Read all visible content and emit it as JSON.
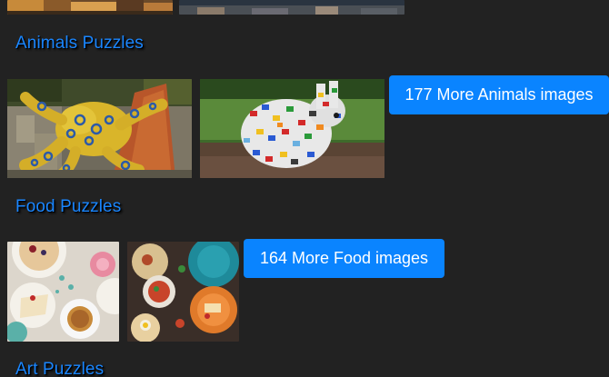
{
  "sections": [
    {
      "title": "Animals Puzzles",
      "more_label": "177 More Animals images",
      "images": [
        "lego-octopus-image",
        "lego-colorful-bunny-image"
      ]
    },
    {
      "title": "Food Puzzles",
      "more_label": "164 More Food images",
      "images": [
        "dessert-tea-table-image",
        "mexican-food-table-image"
      ]
    },
    {
      "title": "Art Puzzles"
    }
  ],
  "colors": {
    "background": "#222222",
    "heading": "#1a86ff",
    "button": "#0a84ff",
    "button_text": "#ffffff"
  }
}
